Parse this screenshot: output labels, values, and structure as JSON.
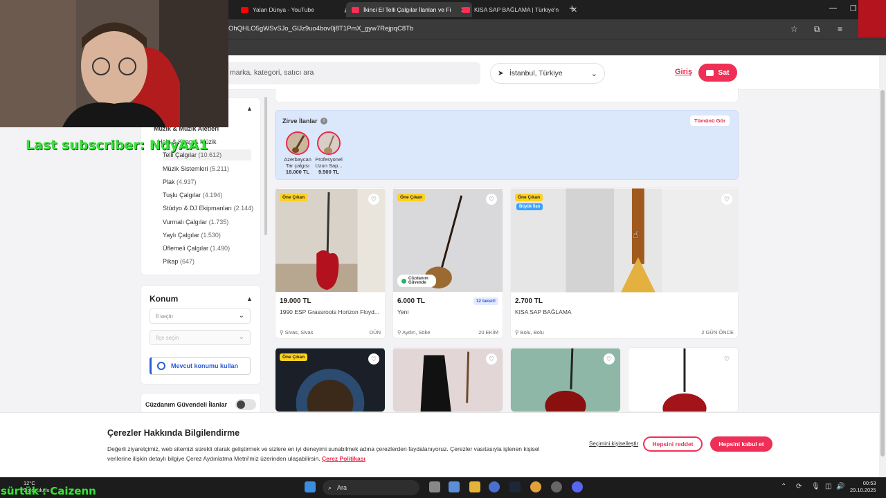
{
  "browser": {
    "tabs": [
      {
        "label": "Yalan Dünya - YouTube",
        "favicon_color": "#ff0000",
        "audio": true,
        "active": false
      },
      {
        "label": "İkinci El Telli Çalgılar İlanları ve Fi",
        "favicon_color": "#ff2d55",
        "active": true
      },
      {
        "label": "KISA SAP BAĞLAMA | Türkiye'n",
        "favicon_color": "#ff2d55",
        "active": false
      }
    ],
    "url": "OhQHLO5gWSvSJo_GlJz9uo4bov0j8T1PmX_gyw7RejpqC8Tb"
  },
  "header": {
    "search_placeholder": "marka, kategori, satıcı ara",
    "location": "İstanbul, Türkiye",
    "login": "Giriş",
    "sell": "Sat"
  },
  "sidebar": {
    "category_parent": "Müzik & Müzik Aletleri",
    "category_root": "Hobi & Kitap & Müzik",
    "items": [
      {
        "label": "Telli Çalgılar",
        "count": "(10.612)",
        "selected": true
      },
      {
        "label": "Müzik Sistemleri",
        "count": "(5.211)"
      },
      {
        "label": "Plak",
        "count": "(4.937)"
      },
      {
        "label": "Tuşlu Çalgılar",
        "count": "(4.194)"
      },
      {
        "label": "Stüdyo & DJ Ekipmanları",
        "count": "(2.144)"
      },
      {
        "label": "Vurmalı Çalgılar",
        "count": "(1.735)"
      },
      {
        "label": "Yaylı Çalgılar",
        "count": "(1.530)"
      },
      {
        "label": "Üflemeli Çalgılar",
        "count": "(1.490)"
      },
      {
        "label": "Pikap",
        "count": "(647)"
      }
    ],
    "konum": {
      "title": "Konum",
      "il_placeholder": "İl seçin",
      "ilce_placeholder": "İlçe seçin",
      "current_location": "Mevcut konumu kullan"
    },
    "wallet_filter": "Cüzdanım Güvendeli İlanlar"
  },
  "zirve": {
    "title": "Zirve İlanlar",
    "see_all": "Tümünü Gör",
    "items": [
      {
        "line1": "Azerbaycan",
        "line2": "Tar çalgısı",
        "price": "18.000 TL"
      },
      {
        "line1": "Profesyonel",
        "line2": "Uzun Sap...",
        "price": "9.500 TL"
      }
    ]
  },
  "listings": [
    {
      "price": "19.000 TL",
      "title": "1990 ESP Grassroots Horizon Floyd...",
      "location": "Sivas, Sivas",
      "date": "DÜN",
      "badge": "Öne Çıkan"
    },
    {
      "price": "6.000 TL",
      "title": "Yeni",
      "location": "Aydın, Söke",
      "date": "20 EKİM",
      "badge": "Öne Çıkan",
      "taksit": "12 taksit!",
      "wallet": "Cüzdanım Güvende"
    },
    {
      "price": "2.700 TL",
      "title": "KISA SAP BAĞLAMA",
      "location": "Bolu, Bolu",
      "date": "2 GÜN ÖNCE",
      "badge": "Öne Çıkan",
      "badge2": "Büyük İlan"
    },
    {
      "badge": "Öne Çıkan"
    }
  ],
  "cookie": {
    "title": "Çerezler Hakkında Bilgilendirme",
    "text": "Değerli ziyaretçimiz, web sitemizi sürekli olarak geliştirmek ve sizlere en iyi deneyimi sunabilmek adına çerezlerden faydalanıyoruz. Çerezler vasıtasıyla işlenen kişisel verilerine ilişkin detaylı bilgiye Çerez Aydınlatma Metni'miz üzerinden ulaşabilirsin.",
    "link": "Çerez Politikası",
    "manage": "Seçimini kişiselleştir",
    "reject": "Hepsini reddet",
    "accept": "Hepsini kabul et"
  },
  "taskbar": {
    "search": "Ara",
    "weather_temp": "12°C",
    "weather_text": "Çok bulutlu",
    "time": "00:53",
    "date": "29.10.2025"
  },
  "overlays": {
    "last_subscriber": "Last subscriber: NdyAA1",
    "follower": "sürtük : Caizenn"
  }
}
